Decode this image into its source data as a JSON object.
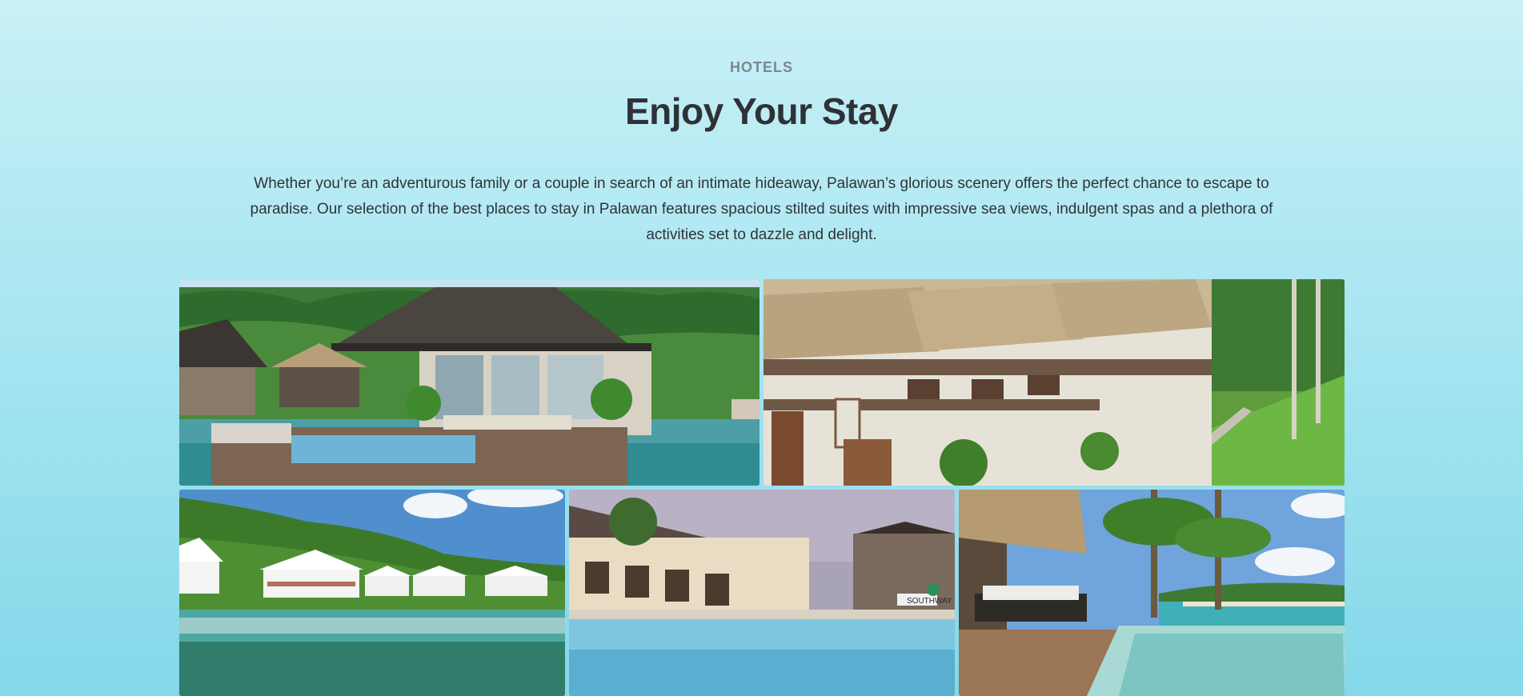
{
  "section": {
    "eyebrow": "HOTELS",
    "title": "Enjoy Your Stay",
    "description": "Whether you’re an adventurous family or a couple in search of an intimate hideaway, Palawan’s glorious scenery offers the perfect chance to escape to paradise. Our selection of the best places to stay in Palawan features spacious stilted suites with impressive sea views, indulgent spas and a plethora of activities set to dazzle and delight."
  },
  "gallery": {
    "images": [
      {
        "subject": "overwater villa with plunge pool and sun loungers"
      },
      {
        "subject": "row of thatched-roof cottages beside a lawn"
      },
      {
        "subject": "white stilted cottages over a clear lagoon"
      },
      {
        "subject": "resort swimming pool at dusk",
        "sign_text": "SOUTHWAY"
      },
      {
        "subject": "daybed and infinity pool under palm trees"
      }
    ]
  }
}
